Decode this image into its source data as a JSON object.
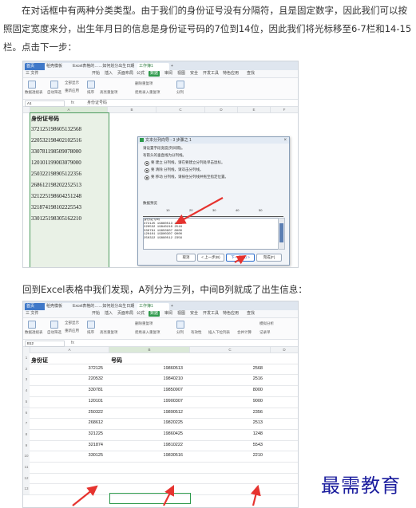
{
  "paragraph1": "在对话框中有两种分类类型。由于我们的身份证号没有分隔符，且是固定数字，因此我们可以按照固定宽度来分，出生年月日的信息是身份证号码的7位到14位，因此我们将光标移至6-7栏和14-15栏。点击下一步：",
  "paragraph2": "回到Excel表格中我们发现，A列分为三列，中间B列就成了出生信息：",
  "watermark": "最需教育",
  "screenshot1": {
    "tabs": [
      "首页",
      "稻壳模板",
      "Excel表格的……如何划分出生日期",
      "工作簿1"
    ],
    "menu": [
      "三 文件",
      "开始",
      "插入",
      "页面布局",
      "公式",
      "数据",
      "审阅",
      "视图",
      "安全",
      "开发工具",
      "特色应用",
      "查找"
    ],
    "menu_selected": "数据",
    "ribbon": [
      "数据透视表",
      "自动筛选",
      "全部显示",
      "重新应用",
      "排序",
      "高亮重复项",
      "拒绝录入重复项",
      "删除重复项",
      "分列"
    ],
    "name_box": "A1",
    "fx": "fx",
    "formula": "身份证号码",
    "columns": [
      "A",
      "B",
      "C",
      "D",
      "E",
      "F"
    ],
    "id_header": "身份证号码",
    "ids": [
      "372125198605132568",
      "220532198402102516",
      "330781198509078000",
      "120101199003079000",
      "250322198905122356",
      "268612198202252513",
      "321225198604251248",
      "321874198102225543",
      "330125198305162210"
    ],
    "dialog": {
      "title": "文本分列向导 - 3 步骤之 1",
      "line1": "请设置字段宽度(列间隔)。",
      "line2": "有箭头的垂直线为分列线。",
      "opt1": "要 建立 分列线，请在要建立分列处单击鼠标。",
      "opt2": "要 清除 分列线，请双击分列线。",
      "opt3": "要 移动 分列线，请按住分列线并拖至指定位置。",
      "preview_label": "数据预览",
      "ruler_ticks": [
        "10",
        "20",
        "30",
        "40",
        "50"
      ],
      "preview_rows": [
        "身份证号码",
        "372125 19860513 2568",
        "220532 19840210 2516",
        "330781 19850907 8000",
        "120101 19900307 9000",
        "250322 19890512 2356"
      ],
      "buttons": [
        "取消",
        "< 上一步(B)",
        "下一步(N) >",
        "完成(F)"
      ]
    }
  },
  "screenshot2": {
    "tabs": [
      "首页",
      "稻壳模板",
      "Excel表格的……如何划分出生日期",
      "工作簿1"
    ],
    "menu": [
      "三 文件",
      "开始",
      "插入",
      "页面布局",
      "公式",
      "数据",
      "审阅",
      "视图",
      "安全",
      "开发工具",
      "特色应用",
      "查找"
    ],
    "menu_selected": "数据",
    "ribbon": [
      "数据透视表",
      "自动筛选",
      "全部显示",
      "重新应用",
      "排序",
      "高亮重复项",
      "拒绝录入重复项",
      "删除重复项",
      "分列",
      "有效性",
      "插入下拉列表",
      "合并计算",
      "模拟分析",
      "记录单"
    ],
    "name_box": "B12",
    "fx": "fx",
    "columns": [
      "A",
      "B",
      "C",
      "D"
    ],
    "header_a": "身份证",
    "header_b": "号码",
    "rows": [
      [
        "372125",
        "19860513",
        "2568"
      ],
      [
        "220532",
        "19840210",
        "2516"
      ],
      [
        "330781",
        "19850907",
        "8000"
      ],
      [
        "120101",
        "19900307",
        "9000"
      ],
      [
        "250322",
        "19890512",
        "2356"
      ],
      [
        "268612",
        "19820225",
        "2513"
      ],
      [
        "321225",
        "19860425",
        "1248"
      ],
      [
        "321874",
        "19810222",
        "5543"
      ],
      [
        "330125",
        "19830516",
        "2210"
      ]
    ],
    "row_numbers": [
      "1",
      "2",
      "3",
      "4",
      "5",
      "6",
      "7",
      "8",
      "9",
      "10",
      "11",
      "12",
      "13"
    ]
  },
  "colors": {
    "accent": "#2e9a4c",
    "arrow": "#e6332f",
    "watermark": "#1c1e9e"
  }
}
